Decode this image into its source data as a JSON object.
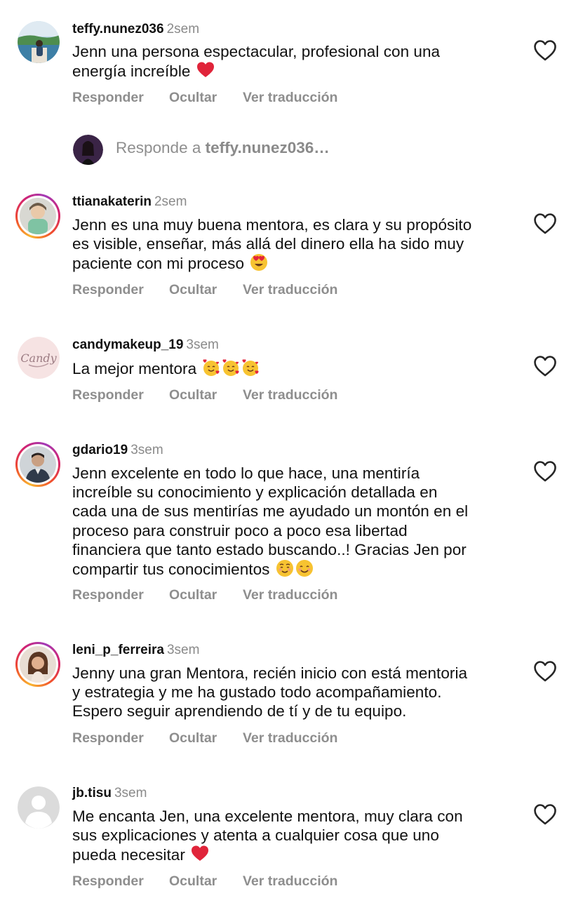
{
  "reply_bar": {
    "prefix": "Responde a ",
    "target": "teffy.nunez036…"
  },
  "actions": {
    "reply": "Responder",
    "hide": "Ocultar",
    "translate": "Ver traducción"
  },
  "comments": [
    {
      "username": "teffy.nunez036",
      "time": "2sem",
      "lines": [
        "Jenn una persona espectacular, profesional con una",
        "energía increíble"
      ],
      "emojis": [
        "red-heart"
      ]
    },
    {
      "username": "ttianakaterin",
      "time": "2sem",
      "lines": [
        "Jenn es una muy buena mentora, es clara y su propósito",
        "es visible, enseñar, más allá del dinero ella ha sido muy",
        "paciente con mi proceso"
      ],
      "emojis": [
        "heart-eyes-face"
      ]
    },
    {
      "username": "candymakeup_19",
      "time": "3sem",
      "lines": [
        "La mejor mentora"
      ],
      "emojis": [
        "smiling-face-with-hearts",
        "smiling-face-with-hearts",
        "smiling-face-with-hearts"
      ],
      "avatar_text": "Candy"
    },
    {
      "username": "gdario19",
      "time": "3sem",
      "lines": [
        "Jenn excelente en todo lo que hace, una mentiría",
        "increíble su conocimiento y explicación detallada en",
        "cada una de sus mentirías me ayudado un montón en el",
        "proceso para construir poco a poco esa libertad",
        "financiera que tanto estado buscando..! Gracias Jen por",
        "compartir tus conocimientos"
      ],
      "emojis": [
        "smiling-face",
        "smiling-face-with-smiling-eyes"
      ]
    },
    {
      "username": "leni_p_ferreira",
      "time": "3sem",
      "lines": [
        "Jenny una gran Mentora, recién inicio con está mentoria",
        "y estrategia y me ha gustado todo acompañamiento.",
        "Espero seguir aprendiendo de tí y de tu equipo."
      ],
      "emojis": []
    },
    {
      "username": "jb.tisu",
      "time": "3sem",
      "lines": [
        "Me encanta Jen, una excelente mentora, muy clara con",
        "sus explicaciones y atenta a cualquier cosa que uno",
        "pueda necesitar"
      ],
      "emojis": [
        "red-heart"
      ]
    }
  ],
  "colors": {
    "text": "#111111",
    "muted": "#8e8e8e",
    "story_ring": [
      "#f9b52f",
      "#d3226f",
      "#a23bb7"
    ],
    "heart_emoji": "#e0243a"
  }
}
